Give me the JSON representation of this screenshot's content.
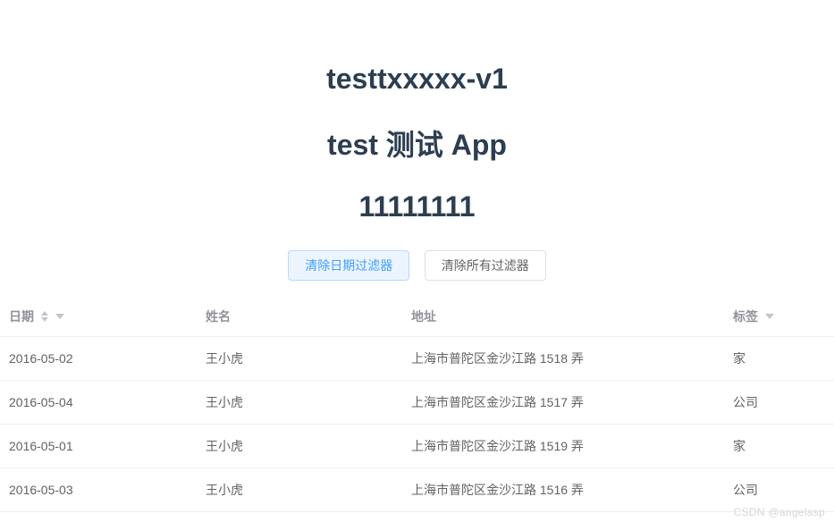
{
  "headings": {
    "h1": "testtxxxxx-v1",
    "h2": "test 测试 App",
    "h3": "11111111"
  },
  "buttons": {
    "clear_date_filter": "清除日期过滤器",
    "clear_all_filters": "清除所有过滤器"
  },
  "table": {
    "columns": {
      "date": "日期",
      "name": "姓名",
      "address": "地址",
      "tag": "标签"
    },
    "rows": [
      {
        "date": "2016-05-02",
        "name": "王小虎",
        "address": "上海市普陀区金沙江路 1518 弄",
        "tag": "家"
      },
      {
        "date": "2016-05-04",
        "name": "王小虎",
        "address": "上海市普陀区金沙江路 1517 弄",
        "tag": "公司"
      },
      {
        "date": "2016-05-01",
        "name": "王小虎",
        "address": "上海市普陀区金沙江路 1519 弄",
        "tag": "家"
      },
      {
        "date": "2016-05-03",
        "name": "王小虎",
        "address": "上海市普陀区金沙江路 1516 弄",
        "tag": "公司"
      }
    ]
  },
  "watermark": "CSDN @angelasp"
}
